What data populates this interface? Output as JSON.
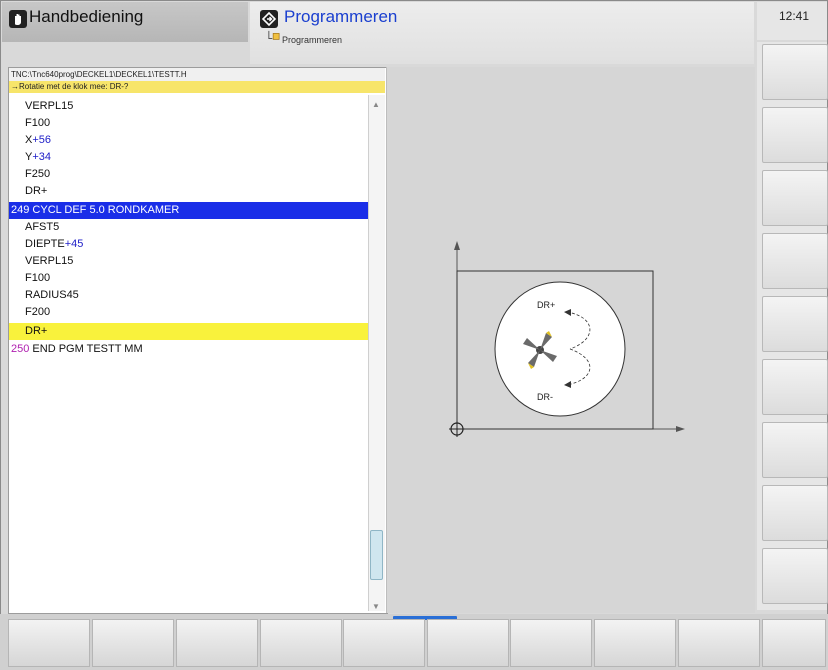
{
  "header": {
    "left_mode": "Handbediening",
    "mid_mode": "Programmeren",
    "mid_sub": "Programmeren",
    "clock": "12:41"
  },
  "program": {
    "path": "TNC:\\Tnc640prog\\DECKEL1\\DECKEL1\\TESTT.H",
    "hint": "→Rotatie met de klok mee: DR-?",
    "lines": [
      {
        "key": "VERPL",
        "val": "15",
        "plain": true
      },
      {
        "key": "F",
        "val": "100",
        "plain": true
      },
      {
        "key": "X",
        "val": "+56"
      },
      {
        "key": "Y",
        "val": "+34"
      },
      {
        "key": "F",
        "val": "250",
        "plain": true
      },
      {
        "key": "DR+",
        "val": "",
        "plain": true
      },
      {
        "num": "249",
        "text": " CYCL DEF 5.0 RONDKAMER"
      },
      {
        "key": "AFST",
        "val": "5",
        "plain": true
      },
      {
        "key": "DIEPTE",
        "val": "+45"
      },
      {
        "key": "VERPL",
        "val": "15",
        "plain": true
      },
      {
        "key": "F",
        "val": "100",
        "plain": true
      },
      {
        "key": "RADIUS",
        "val": "45",
        "plain": true
      },
      {
        "key": "F",
        "val": "200",
        "plain": true
      },
      {
        "key": "DR+",
        "val": "",
        "plain": true
      },
      {
        "num": "250",
        "text": " END PGM TESTT MM"
      }
    ]
  },
  "graphic": {
    "label_top": "DR+",
    "label_bottom": "DR-"
  },
  "colors": {
    "cycle_highlight": "#1a2ee8",
    "current_highlight": "#f9f23c",
    "value_blue": "#2020c8",
    "block_number": "#b020b0",
    "mode_title_blue": "#1a3fcf"
  }
}
